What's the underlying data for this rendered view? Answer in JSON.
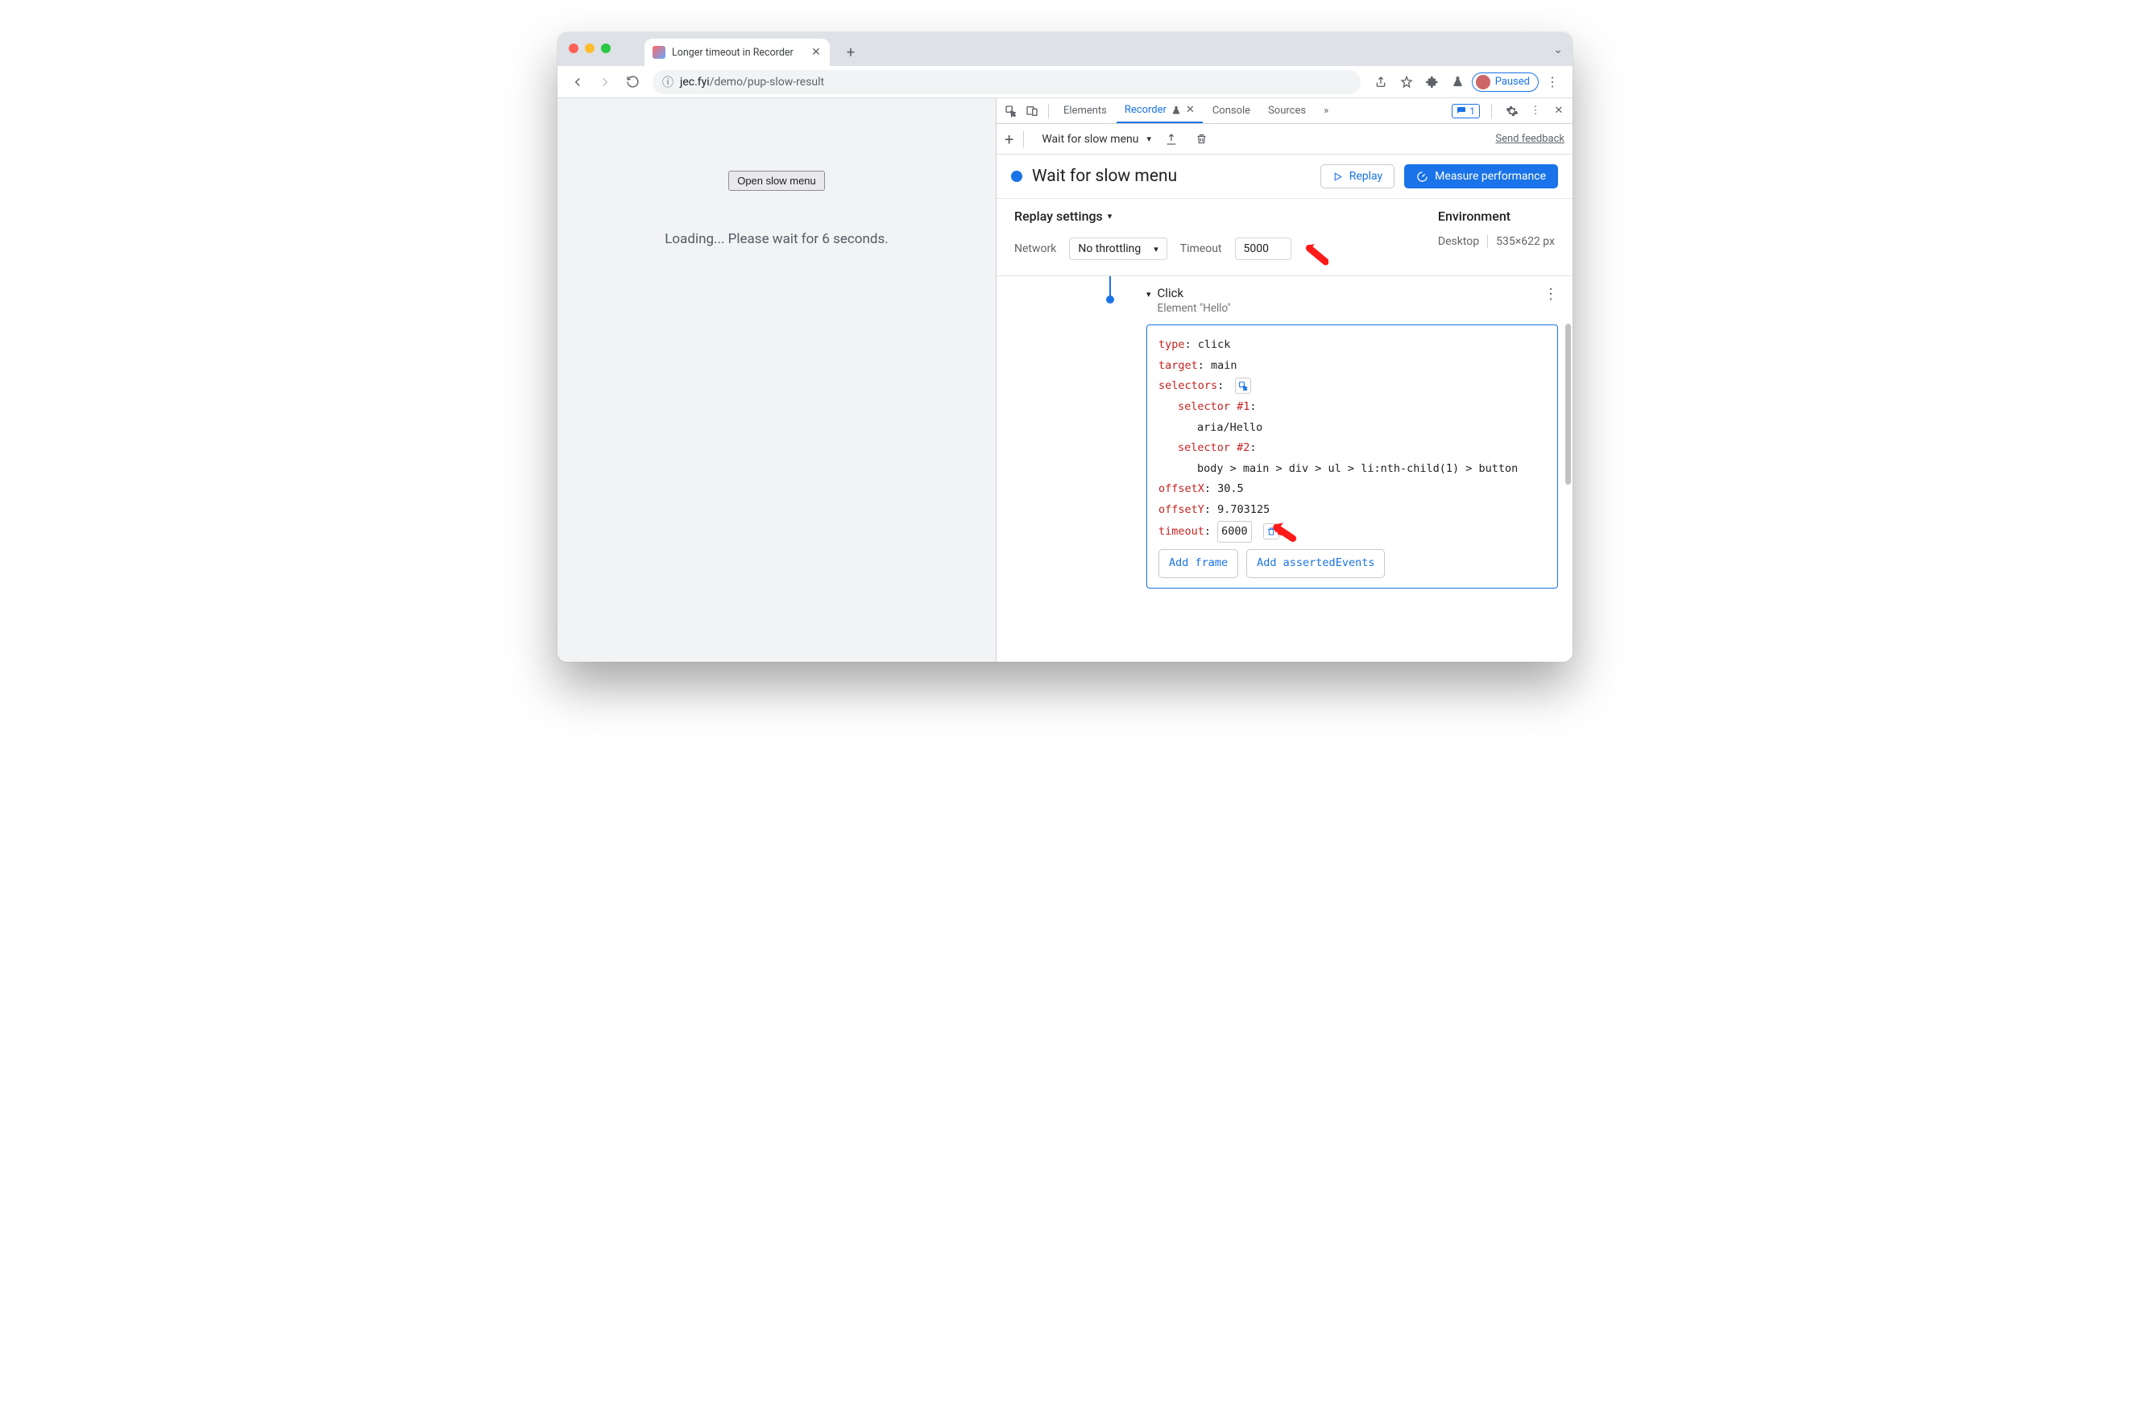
{
  "browser": {
    "tab_title": "Longer timeout in Recorder",
    "url_host": "jec.fyi",
    "url_path": "/demo/pup-slow-result",
    "paused_label": "Paused"
  },
  "page": {
    "button_label": "Open slow menu",
    "loading_text": "Loading... Please wait for 6 seconds."
  },
  "devtools": {
    "tabs": {
      "elements": "Elements",
      "recorder": "Recorder",
      "console": "Console",
      "sources": "Sources"
    },
    "issue_count": "1",
    "toolbar": {
      "recording_name": "Wait for slow menu",
      "feedback": "Send feedback"
    },
    "header": {
      "title": "Wait for slow menu",
      "replay": "Replay",
      "measure": "Measure performance"
    },
    "settings": {
      "header": "Replay settings",
      "network_label": "Network",
      "network_value": "No throttling",
      "timeout_label": "Timeout",
      "timeout_value": "5000",
      "env_header": "Environment",
      "env_device": "Desktop",
      "env_dims": "535×622 px"
    },
    "step": {
      "title": "Click",
      "subtitle": "Element \"Hello\"",
      "type_k": "type",
      "type_v": "click",
      "target_k": "target",
      "target_v": "main",
      "selectors_k": "selectors",
      "sel1_k": "selector #1",
      "sel1_v": "aria/Hello",
      "sel2_k": "selector #2",
      "sel2_v": "body > main > div > ul > li:nth-child(1) > button",
      "offx_k": "offsetX",
      "offx_v": "30.5",
      "offy_k": "offsetY",
      "offy_v": "9.703125",
      "timeout_k": "timeout",
      "timeout_v": "6000",
      "add_frame": "Add frame",
      "add_asserted": "Add assertedEvents"
    }
  }
}
